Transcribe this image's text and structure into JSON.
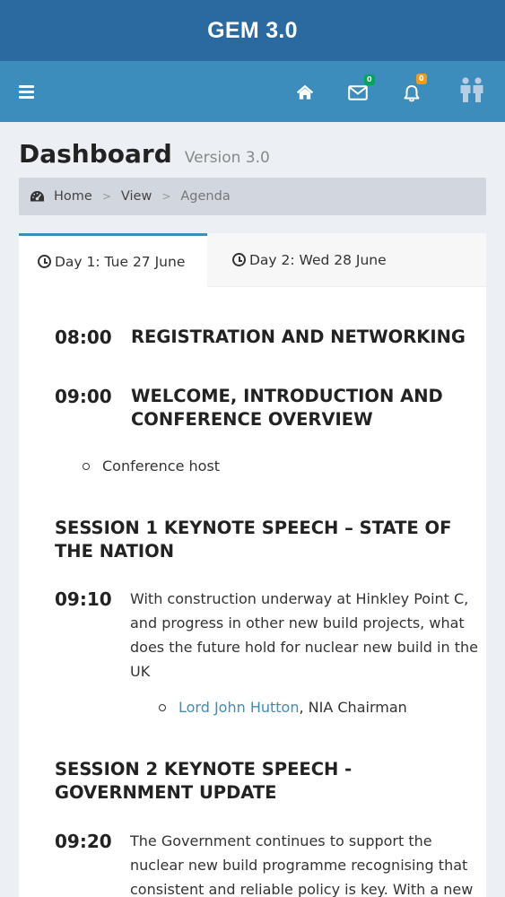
{
  "app": {
    "title": "GEM 3.0"
  },
  "navbar": {
    "icons": [
      "menu-icon",
      "home-icon",
      "envelope-icon",
      "bell-icon",
      "users-icon"
    ],
    "messages_count": "0",
    "notifications_count": "0",
    "colors": {
      "title_bar": "#2a6aa0",
      "navbar": "#3c8dbc",
      "messages_badge": "#00a65a",
      "notifications_badge": "#f39c12"
    }
  },
  "header": {
    "title": "Dashboard",
    "subtitle": "Version 3.0"
  },
  "breadcrumb": {
    "icon": "dashboard-icon",
    "items": [
      "Home",
      "View",
      "Agenda"
    ]
  },
  "tabs": [
    {
      "label": "Day 1: Tue 27 June",
      "active": true,
      "icon": "clock-icon"
    },
    {
      "label": "Day 2: Wed 28 June",
      "active": false,
      "icon": "clock-icon"
    }
  ],
  "agenda": {
    "registration": {
      "time": "08:00",
      "title": "REGISTRATION AND NETWORKING"
    },
    "welcome": {
      "time": "09:00",
      "title_line1": "WELCOME, INTRODUCTION AND",
      "title_line2": "CONFERENCE OVERVIEW",
      "speaker": "Conference host"
    },
    "session1": {
      "title_line1": "SESSION 1 KEYNOTE SPEECH – STATE OF",
      "title_line2": "THE NATION",
      "time": "09:10",
      "desc_lines": [
        "With construction underway at Hinkley Point C,",
        "and progress in other new build projects, what",
        "does the future hold for nuclear new build in the",
        "UK"
      ],
      "speaker_name": "Lord John Hutton",
      "speaker_role": ", NIA Chairman"
    },
    "session2": {
      "title_line1": "SESSION 2 KEYNOTE SPEECH -",
      "title_line2": "GOVERNMENT UPDATE",
      "time": "09:20",
      "desc_lines": [
        "The Government continues to support the",
        "nuclear new build programme recognising that",
        "consistent and reliable policy is key. With a new"
      ]
    }
  }
}
